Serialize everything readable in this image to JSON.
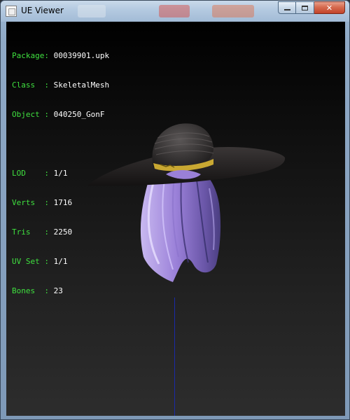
{
  "window": {
    "title": "UE Viewer",
    "controls": {
      "minimize": "minimize",
      "maximize": "maximize",
      "close": "✕"
    }
  },
  "info": {
    "package": {
      "key": "Package:",
      "value": "00039901.upk"
    },
    "class": {
      "key": "Class  :",
      "value": "SkeletalMesh"
    },
    "object": {
      "key": "Object :",
      "value": "040250_GonF"
    },
    "lod": {
      "key": "LOD    :",
      "value": "1/1"
    },
    "verts": {
      "key": "Verts  :",
      "value": "1716"
    },
    "tris": {
      "key": "Tris   :",
      "value": "2250"
    },
    "uvset": {
      "key": "UV Set :",
      "value": "1/1"
    },
    "bones": {
      "key": "Bones  :",
      "value": "23"
    }
  },
  "colors": {
    "label_green": "#3fe03f",
    "value_white": "#ffffff",
    "axis_blue": "#1a2aa8",
    "hair_purple": "#a890e0",
    "hat_dark": "#2a2a2a"
  }
}
